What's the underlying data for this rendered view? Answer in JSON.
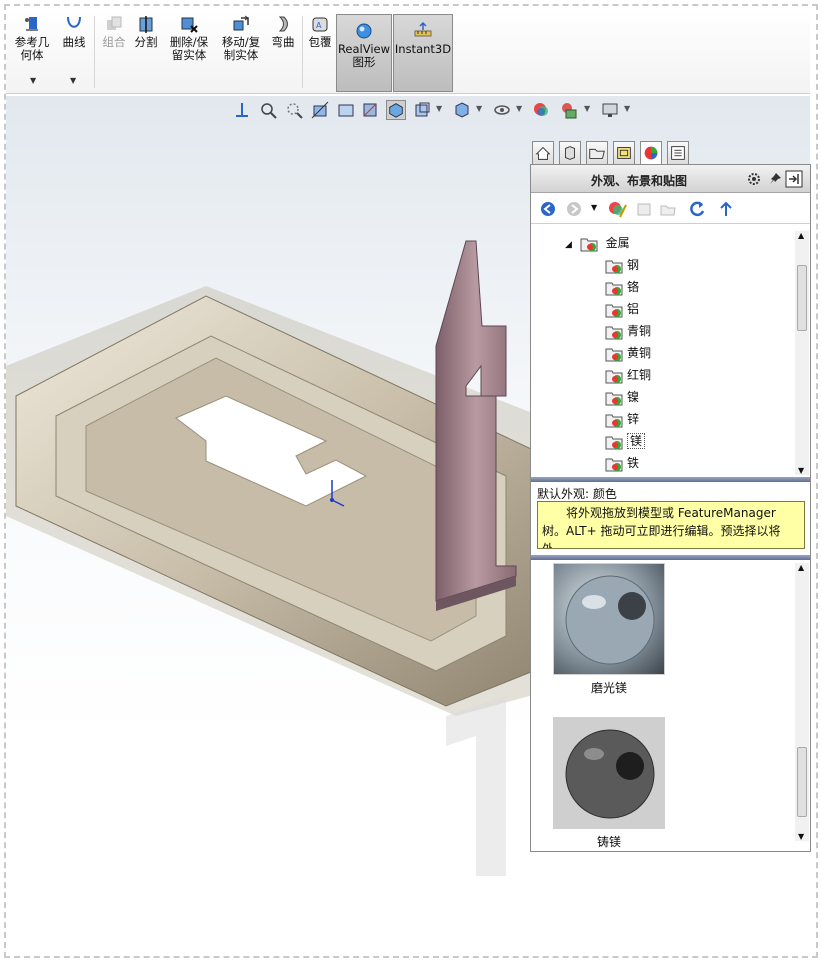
{
  "ribbon": {
    "buttons": [
      {
        "label": "参考几何体",
        "icon": "reference-geometry-icon",
        "disabled": false
      },
      {
        "label": "曲线",
        "icon": "curves-icon",
        "disabled": false
      },
      {
        "label": "组合",
        "icon": "combine-icon",
        "disabled": true
      },
      {
        "label": "分割",
        "icon": "split-icon",
        "disabled": false
      },
      {
        "label": "删除/保留实体",
        "icon": "delete-keep-body-icon",
        "disabled": false
      },
      {
        "label": "移动/复制实体",
        "icon": "move-copy-body-icon",
        "disabled": false
      },
      {
        "label": "弯曲",
        "icon": "flex-icon",
        "disabled": false
      },
      {
        "label": "包覆",
        "icon": "wrap-icon",
        "disabled": false
      },
      {
        "label": "RealView图形",
        "icon": "realview-icon",
        "disabled": false,
        "active": true
      },
      {
        "label": "Instant3D",
        "icon": "instant3d-icon",
        "disabled": false,
        "active": true
      }
    ],
    "l1": "参考几",
    "l2": "何体",
    "curves": "曲线",
    "combine": "组合",
    "split": "分割",
    "del1": "删除/保",
    "del2": "留实体",
    "mov1": "移动/复",
    "mov2": "制实体",
    "flex": "弯曲",
    "wrap": "包覆",
    "rv1": "RealView",
    "rv2": "图形",
    "i3d": "Instant3D"
  },
  "task_pane": {
    "title": "外观、布景和贴图",
    "tabs": [
      "home-icon",
      "3d-parts-icon",
      "file-explorer-icon",
      "view-palette-icon",
      "appearances-icon",
      "custom-properties-icon"
    ],
    "tree_root": "金属",
    "tree_items": [
      "钢",
      "铬",
      "铝",
      "青铜",
      "黄铜",
      "红铜",
      "镍",
      "锌",
      "镁",
      "铁"
    ],
    "selected": "镁",
    "default_appearance": "默认外观: 颜色",
    "tooltip_line1": "将外观拖放到模型或 FeatureManager",
    "tooltip_line2": "树。ALT+ 拖动可立即进行编辑。预选择以将外...",
    "thumbnails": [
      "磨光镁",
      "铸镁"
    ]
  },
  "colors": {
    "accent_blue": "#2a66c8",
    "tooltip_bg": "#ffffa6",
    "part_bronze": "#bdb3a0",
    "part_pink": "#9b7a84"
  }
}
